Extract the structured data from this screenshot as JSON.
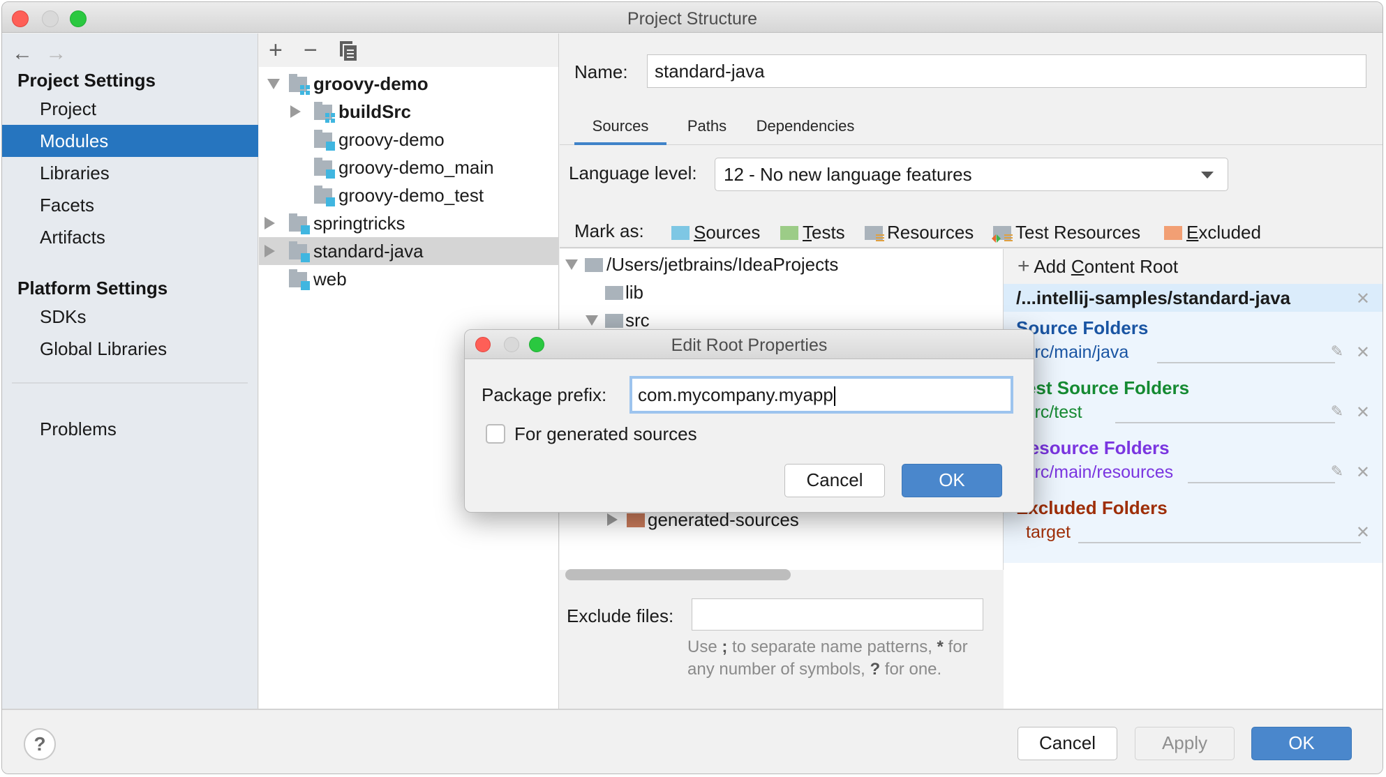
{
  "window": {
    "title": "Project Structure"
  },
  "sidebar": {
    "nav": {
      "back": "←",
      "forward": "→"
    },
    "groups": [
      {
        "label": "Project Settings",
        "items": [
          "Project",
          "Modules",
          "Libraries",
          "Facets",
          "Artifacts"
        ]
      },
      {
        "label": "Platform Settings",
        "items": [
          "SDKs",
          "Global Libraries"
        ]
      }
    ],
    "selected": "Modules",
    "footer_items": [
      "Problems"
    ]
  },
  "module_tree": {
    "toolbar": {
      "add": "+",
      "remove": "−",
      "copy": "copy-icon"
    },
    "rows": [
      {
        "label": "groovy-demo",
        "bold": true,
        "expanded": true,
        "level": 0,
        "icon": "module-group-icon"
      },
      {
        "label": "buildSrc",
        "bold": true,
        "expanded": false,
        "level": 1,
        "icon": "module-group-icon"
      },
      {
        "label": "groovy-demo",
        "bold": false,
        "level": 1,
        "icon": "module-icon"
      },
      {
        "label": "groovy-demo_main",
        "bold": false,
        "level": 1,
        "icon": "module-icon"
      },
      {
        "label": "groovy-demo_test",
        "bold": false,
        "level": 1,
        "icon": "module-icon"
      },
      {
        "label": "springtricks",
        "bold": false,
        "expanded": false,
        "level": 0,
        "icon": "module-icon"
      },
      {
        "label": "standard-java",
        "bold": false,
        "expanded": false,
        "level": 0,
        "icon": "module-icon",
        "selected": true
      },
      {
        "label": "web",
        "bold": false,
        "level": 0,
        "icon": "module-icon"
      }
    ]
  },
  "module": {
    "name_label": "Name:",
    "name_value": "standard-java",
    "tabs": [
      {
        "label": "Sources",
        "active": true
      },
      {
        "label": "Paths",
        "active": false
      },
      {
        "label": "Dependencies",
        "active": false
      }
    ],
    "language_level_label": "Language level:",
    "language_level_value": "12 - No new language features",
    "mark_as_label": "Mark as:",
    "mark_as": [
      {
        "label": "Sources",
        "mnemonic": "S",
        "rest": "ources",
        "color": "#7ec7e4"
      },
      {
        "label": "Tests",
        "mnemonic": "T",
        "rest": "ests",
        "color": "#9ccc87"
      },
      {
        "label": "Resources",
        "color": "#aab3bb"
      },
      {
        "label": "Test Resources",
        "color": "#aab3bb"
      },
      {
        "label": "Excluded",
        "mnemonic": "E",
        "rest": "xcluded",
        "color": "#f29f74"
      }
    ],
    "content_tree": [
      {
        "label": "/Users/jetbrains/IdeaProjects",
        "expanded": true
      },
      {
        "label": "lib"
      },
      {
        "label": "src",
        "expanded": true
      },
      {
        "label": "generated-sources",
        "expanded": false
      }
    ],
    "exclude_files_label": "Exclude files:",
    "exclude_files_value": "",
    "exclude_hint_parts": [
      "Use ",
      ";",
      " to separate name patterns, ",
      "*",
      " for any number of symbols, ",
      "?",
      " for one."
    ]
  },
  "content_roots": {
    "add_label_pre": "Add ",
    "add_label_mnemonic": "C",
    "add_label_post": "ontent Root",
    "root_path": "/...intellij-samples/standard-java",
    "groups": [
      {
        "title": "Source Folders",
        "path": "src/main/java",
        "color": "#1a55a3",
        "editable": true
      },
      {
        "title": "Test Source Folders",
        "path": "src/test",
        "color": "#158a32",
        "editable": true
      },
      {
        "title": "Resource Folders",
        "path": "src/main/resources",
        "color": "#7a35e0",
        "editable": true
      },
      {
        "title": "Excluded Folders",
        "path": "target",
        "color": "#9e2e08",
        "editable": false
      }
    ]
  },
  "footer": {
    "help": "?",
    "cancel": "Cancel",
    "apply": "Apply",
    "ok": "OK"
  },
  "dialog": {
    "title": "Edit Root Properties",
    "package_prefix_label": "Package prefix:",
    "package_prefix_value": "com.mycompany.myapp",
    "generated_sources_label": "For generated sources",
    "generated_sources_checked": false,
    "cancel": "Cancel",
    "ok": "OK"
  }
}
